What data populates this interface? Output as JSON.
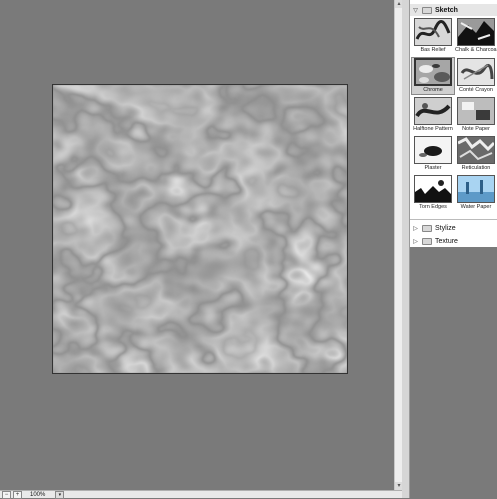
{
  "filter_gallery": {
    "zoom": "100%",
    "zoom_out_symbol": "−",
    "zoom_in_symbol": "+",
    "dropdown_symbol": "▾",
    "expanded_symbol": "▽",
    "collapsed_symbol": "▷",
    "scroll_up": "▴",
    "scroll_down": "▾",
    "groups": [
      {
        "name": "Sketch",
        "expanded": true
      },
      {
        "name": "Stylize",
        "expanded": false
      },
      {
        "name": "Texture",
        "expanded": false
      }
    ],
    "sketch_filters": [
      {
        "name": "Bas Relief",
        "selected": false
      },
      {
        "name": "Chalk & Charcoal",
        "selected": false
      },
      {
        "name": "Chrome",
        "selected": true
      },
      {
        "name": "Conté Crayon",
        "selected": false
      },
      {
        "name": "Halftone Pattern",
        "selected": false
      },
      {
        "name": "Note Paper",
        "selected": false
      },
      {
        "name": "Plaster",
        "selected": false
      },
      {
        "name": "Reticulation",
        "selected": false
      },
      {
        "name": "Torn Edges",
        "selected": false
      },
      {
        "name": "Water Paper",
        "selected": false
      }
    ],
    "colors": {
      "workspace": "#7a7a7a",
      "panel": "#ffffff",
      "selection": "#d0d0d0"
    }
  }
}
